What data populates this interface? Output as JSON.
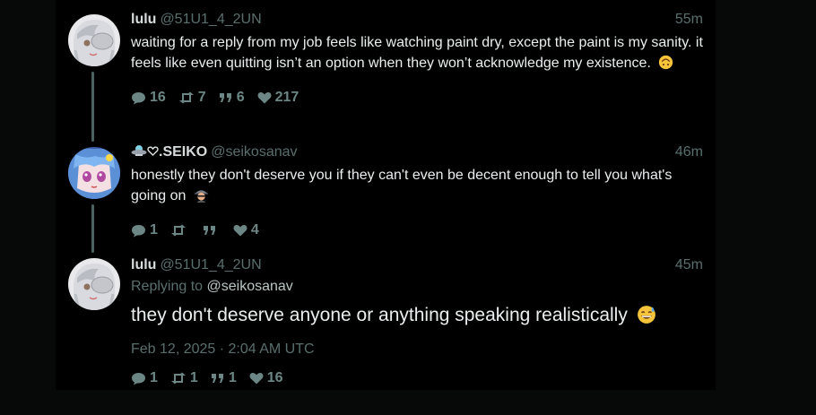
{
  "posts": [
    {
      "name": "lulu",
      "handle": "@51U1_4_2UN",
      "time": "55m",
      "text": "waiting for a reply from my job feels like watching paint dry, except the paint is my sanity. it feels like even quitting isn’t an option when they won’t acknowledge my existence.",
      "emoji": "upside-down-face",
      "replies": "16",
      "reposts": "7",
      "quotes": "6",
      "likes": "217"
    },
    {
      "name_prefix_icons": [
        "flying-saucer",
        "heart-outline"
      ],
      "name": ".SEIKO",
      "handle": "@seikosanav",
      "time": "46m",
      "text": "honestly they don't deserve you if they can't even be decent enough to tell you what's going on",
      "emoji": "spy",
      "replies": "1",
      "reposts": "",
      "quotes": "",
      "likes": "4"
    },
    {
      "name": "lulu",
      "handle": "@51U1_4_2UN",
      "time": "45m",
      "replying_label": "Replying to",
      "replying_to": "@seikosanav",
      "text": "they don't deserve anyone or anything speaking realistically",
      "emoji": "grinning-sweat",
      "date": "Feb 12, 2025 · 2:04 AM UTC",
      "replies": "1",
      "reposts": "1",
      "quotes": "1",
      "likes": "16"
    }
  ],
  "colors": {
    "background": "#060908",
    "panel": "#000000",
    "accent_muted": "#596f6d",
    "thread_line": "#4b6260"
  }
}
